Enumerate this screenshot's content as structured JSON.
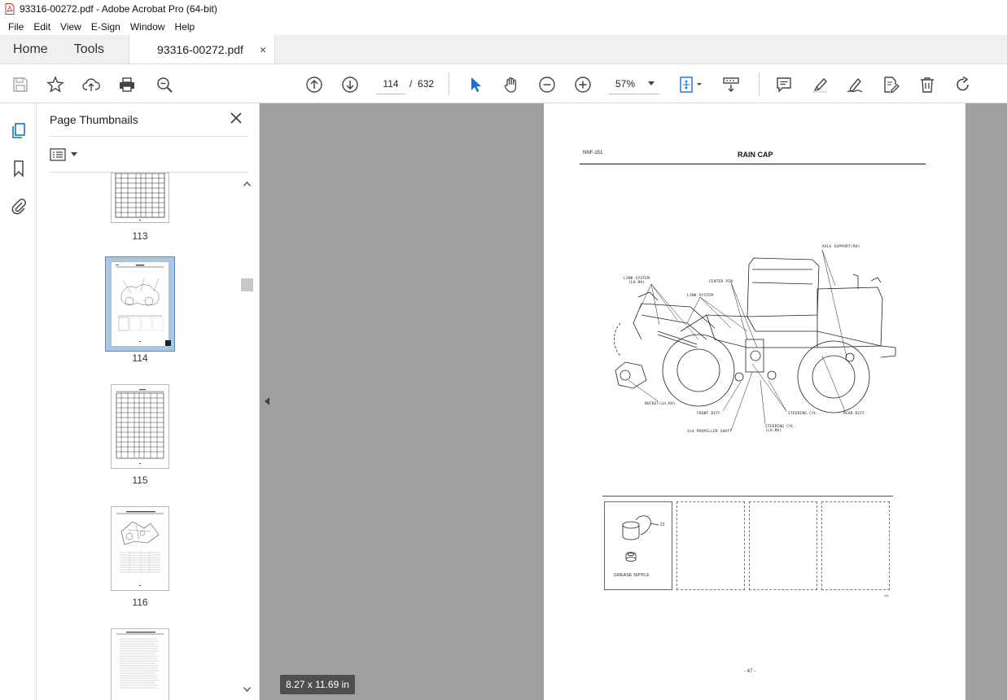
{
  "window": {
    "title": "93316-00272.pdf - Adobe Acrobat Pro (64-bit)"
  },
  "menu": [
    "File",
    "Edit",
    "View",
    "E-Sign",
    "Window",
    "Help"
  ],
  "tabs": {
    "home": "Home",
    "tools": "Tools",
    "document": "93316-00272.pdf",
    "close": "×"
  },
  "toolbar": {
    "current_page": "114",
    "page_separator": "/",
    "total_pages": "632",
    "zoom": "57%"
  },
  "panel": {
    "title": "Page Thumbnails",
    "close": "✕"
  },
  "thumbnails": [
    {
      "label": "113"
    },
    {
      "label": "114"
    },
    {
      "label": "115"
    },
    {
      "label": "116"
    }
  ],
  "viewer": {
    "page_size": "8.27 x 11.69 in"
  },
  "page": {
    "header_code": "NNF-151",
    "title": "RAIN CAP",
    "labels": {
      "axle_support": "AXLE SUPPORT(RH)",
      "link_system_lh_rh": "LINK SYSTEM\n(LH.RH)",
      "center_pin": "CENTER PIN",
      "link_system": "LINK SYSTEM",
      "bucket": "BUCKET(LH.RH)",
      "front_diff": "FRONT DIFF.",
      "steering_cyl": "STEERING CYL.",
      "rear_diff": "REAR DIFF.",
      "steering_cyl_lh_rh": "STEERING CYL.\n(LH.RH)",
      "propeller_shaft": "2nd PROPELLER SHAFT"
    },
    "grease_nipple": "GREASE NIPPLE",
    "part_number": "21",
    "page_ref": "1/4",
    "page_number": "- 47 -"
  }
}
